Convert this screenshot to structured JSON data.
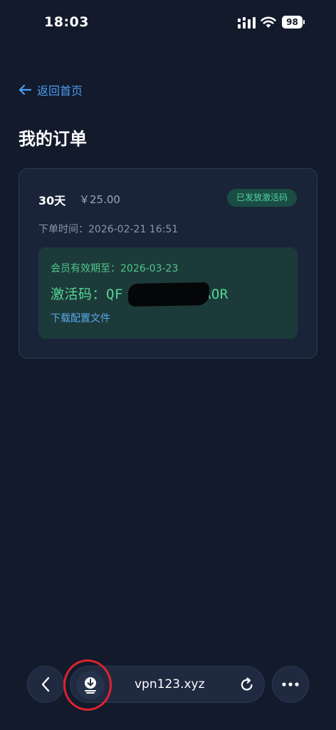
{
  "status_bar": {
    "time": "18:03",
    "battery": "98"
  },
  "nav": {
    "back_label": "返回首页"
  },
  "page": {
    "title": "我的订单"
  },
  "order": {
    "plan": "30天",
    "price": "￥25.00",
    "status": "已发放激活码",
    "order_time": "下单时间：2026-02-21 16:51",
    "expire": "会员有效期至：2026-03-23",
    "activation_code_label": "激活码：",
    "activation_code_visible_start": "QF",
    "activation_code_visible_end": "AOR",
    "download_config_label": "下载配置文件"
  },
  "browser_bar": {
    "url": "vpn123.xyz"
  },
  "colors": {
    "background": "#121a2c",
    "accent_blue": "#4a9cf0",
    "success_green": "#56d693",
    "badge_bg": "#1a4d44",
    "annotation_red": "#e0222e"
  },
  "icons": [
    "back-arrow-icon",
    "signal-icon",
    "wifi-icon",
    "battery-icon",
    "chevron-left-icon",
    "download-icon",
    "reload-icon",
    "more-icon"
  ]
}
